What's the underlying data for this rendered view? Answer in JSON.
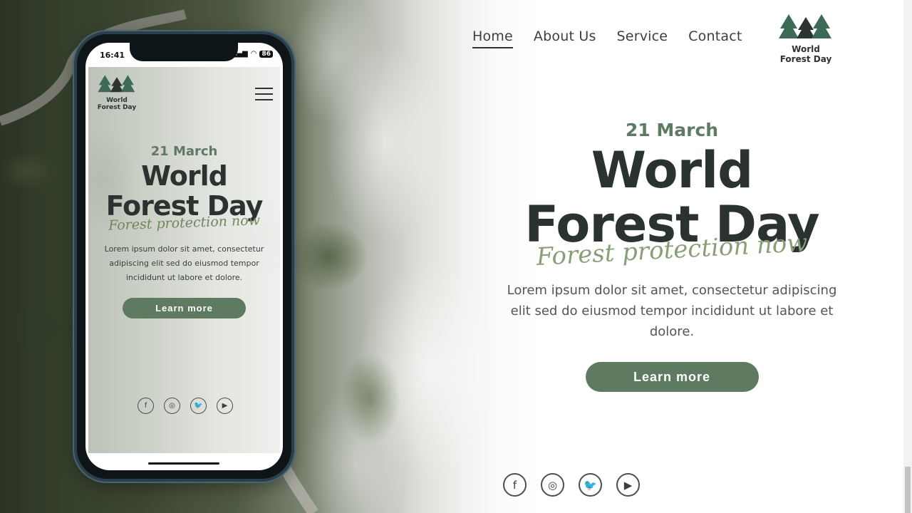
{
  "nav": {
    "items": [
      {
        "label": "Home",
        "active": true
      },
      {
        "label": "About Us",
        "active": false
      },
      {
        "label": "Service",
        "active": false
      },
      {
        "label": "Contact",
        "active": false
      }
    ]
  },
  "logo": {
    "line1": "World",
    "line2": "Forest Day",
    "icon": "pine-trees-icon"
  },
  "hero": {
    "date": "21 March",
    "title_line1": "World",
    "title_line2": "Forest Day",
    "tagline": "Forest protection now",
    "text": "Lorem ipsum dolor sit amet, consectetur adipiscing elit sed do eiusmod tempor incididunt ut labore et dolore.",
    "button": "Learn more"
  },
  "social": [
    {
      "name": "facebook-icon",
      "glyph": "f"
    },
    {
      "name": "instagram-icon",
      "glyph": "◎"
    },
    {
      "name": "twitter-icon",
      "glyph": "🐦"
    },
    {
      "name": "youtube-icon",
      "glyph": "▶"
    }
  ],
  "phone": {
    "status_time": "16:41",
    "battery": "86",
    "logo_line1": "World",
    "logo_line2": "Forest Day",
    "date": "21 March",
    "title_line1": "World",
    "title_line2": "Forest Day",
    "tagline": "Forest protection now",
    "text": "Lorem ipsum dolor sit amet, consectetur adipiscing elit sed do eiusmod tempor incididunt ut labore et dolore.",
    "button": "Learn more"
  },
  "colors": {
    "accent": "#5e7a61",
    "heading": "#2b3331",
    "tagline": "#8a9f78"
  }
}
